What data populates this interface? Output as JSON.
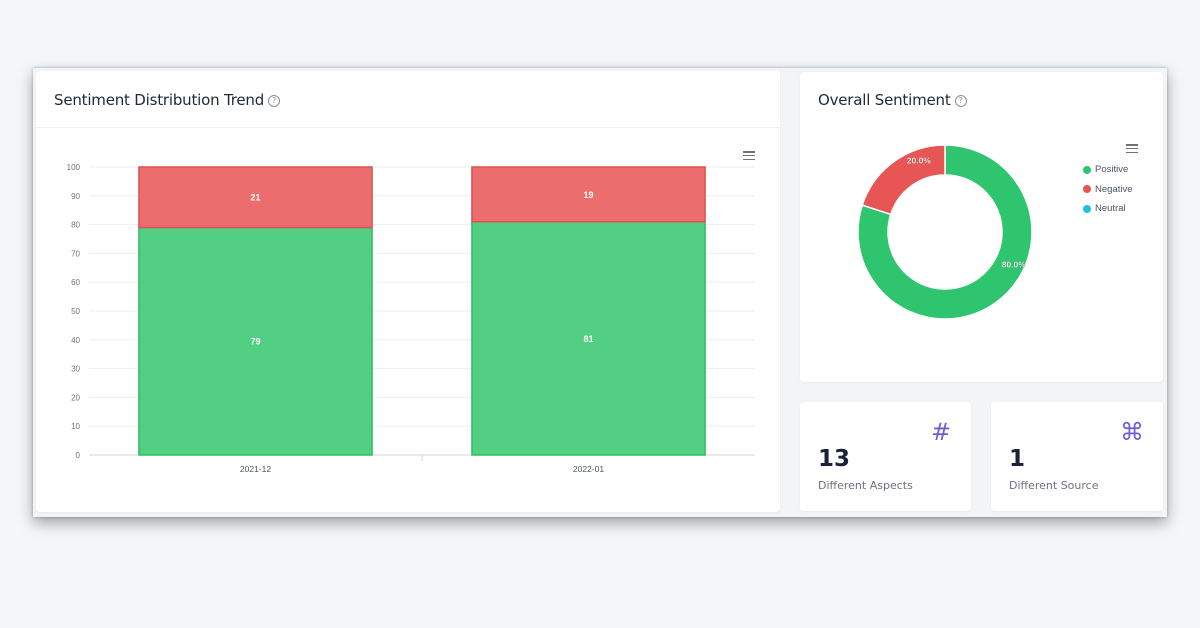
{
  "trend_card": {
    "title": "Sentiment Distribution Trend",
    "help_icon": "?"
  },
  "overall_card": {
    "title": "Overall Sentiment",
    "help_icon": "?"
  },
  "stats": [
    {
      "value": "13",
      "label": "Different Aspects",
      "icon": "#",
      "icon_name": "hash-icon"
    },
    {
      "value": "1",
      "label": "Different Source",
      "icon": "⌘",
      "icon_name": "command-icon"
    }
  ],
  "colors": {
    "positive": "#2ec56e",
    "negative": "#e85555",
    "neutral": "#1ec0e0",
    "accent": "#6d5fd8"
  },
  "chart_data": [
    {
      "type": "bar",
      "stacked": true,
      "title": "Sentiment Distribution Trend",
      "categories": [
        "2021-12",
        "2022-01"
      ],
      "series": [
        {
          "name": "Positive",
          "values": [
            79,
            81
          ],
          "color": "#52cf82"
        },
        {
          "name": "Negative",
          "values": [
            21,
            19
          ],
          "color": "#ec6d6d"
        }
      ],
      "ylim": [
        0,
        100
      ],
      "yticks": [
        0,
        10,
        20,
        30,
        40,
        50,
        60,
        70,
        80,
        90,
        100
      ],
      "grid": true,
      "xlabel": "",
      "ylabel": ""
    },
    {
      "type": "pie",
      "donut": true,
      "title": "Overall Sentiment",
      "labels": [
        "Positive",
        "Negative",
        "Neutral"
      ],
      "values": [
        80.0,
        20.0,
        0.0
      ],
      "value_labels": [
        "80.0%",
        "20.0%",
        ""
      ],
      "colors": [
        "#2ec56e",
        "#e85555",
        "#1ec0e0"
      ],
      "legend": "right"
    }
  ]
}
